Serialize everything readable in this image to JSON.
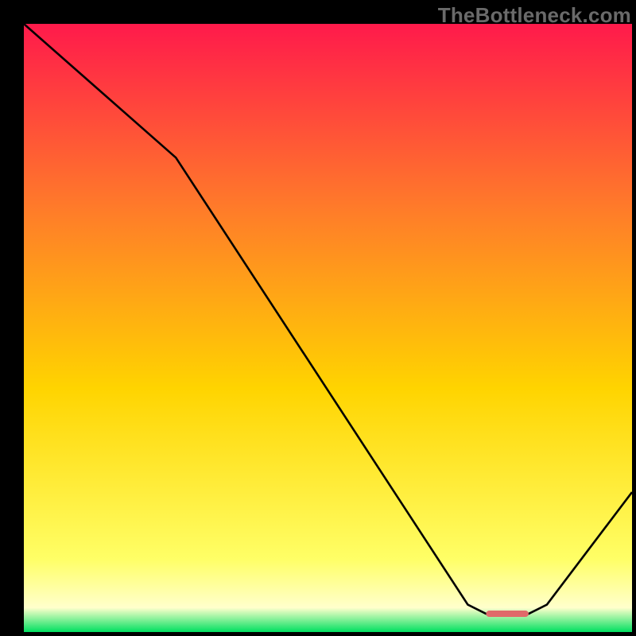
{
  "watermark": "TheBottleneck.com",
  "colors": {
    "gradient_top": "#ff1a4b",
    "gradient_mid_upper": "#ff7a2a",
    "gradient_mid": "#ffd400",
    "gradient_lower_yellow": "#ffff66",
    "gradient_pale": "#ffffcc",
    "gradient_green": "#00e060",
    "line": "#000000",
    "marker": "#e06a6a"
  },
  "chart_data": {
    "type": "line",
    "title": "",
    "xlabel": "",
    "ylabel": "",
    "xlim": [
      0,
      100
    ],
    "ylim": [
      0,
      100
    ],
    "x": [
      0,
      25,
      73,
      76,
      83,
      86,
      100
    ],
    "values": [
      100,
      78,
      4.5,
      3,
      3,
      4.5,
      23
    ],
    "marker": {
      "x_start": 76,
      "x_end": 83,
      "y": 3
    },
    "bands": [
      {
        "y_from": 100,
        "y_to": 70,
        "color_from": "gradient_top",
        "color_to": "gradient_mid_upper"
      },
      {
        "y_from": 70,
        "y_to": 40,
        "color_from": "gradient_mid_upper",
        "color_to": "gradient_mid"
      },
      {
        "y_from": 40,
        "y_to": 12,
        "color_from": "gradient_mid",
        "color_to": "gradient_lower_yellow"
      },
      {
        "y_from": 12,
        "y_to": 4,
        "color_from": "gradient_lower_yellow",
        "color_to": "gradient_pale"
      },
      {
        "y_from": 4,
        "y_to": 0,
        "color_from": "gradient_pale",
        "color_to": "gradient_green"
      }
    ]
  }
}
